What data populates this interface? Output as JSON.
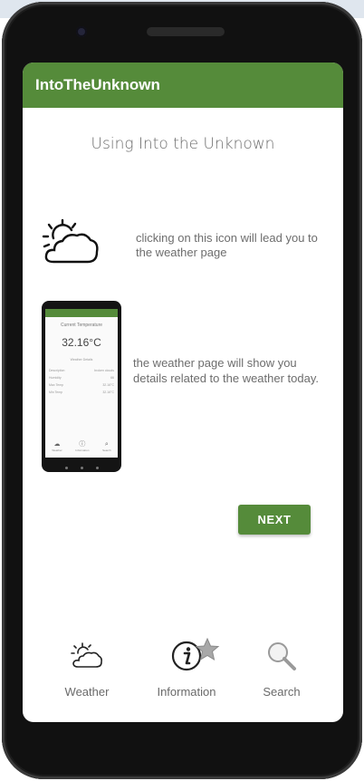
{
  "app": {
    "title": "IntoTheUnknown",
    "accent": "#558b3a"
  },
  "page": {
    "heading": "Using Into the Unknown",
    "weather_icon_hint": "clicking on this icon will lead  you to the weather page",
    "weather_page_hint": "the weather page will show  you details related to the  weather today.",
    "next_label": "NEXT"
  },
  "preview": {
    "heading": "Current Temperature",
    "temperature": "32.16°C",
    "subheading": "Weather Details",
    "rows": [
      {
        "label": "Description",
        "value": "broken clouds"
      },
      {
        "label": "Humidity",
        "value": "66"
      },
      {
        "label": "Max Temp",
        "value": "32.16°C"
      },
      {
        "label": "Min Temp",
        "value": "32.16°C"
      }
    ],
    "nav": [
      "Weather",
      "Information",
      "Search"
    ]
  },
  "bottom_nav": {
    "items": [
      {
        "label": "Weather",
        "icon": "weather-icon"
      },
      {
        "label": "Information",
        "icon": "info-icon"
      },
      {
        "label": "Search",
        "icon": "search-icon"
      }
    ],
    "badge_icon": "star-icon"
  }
}
